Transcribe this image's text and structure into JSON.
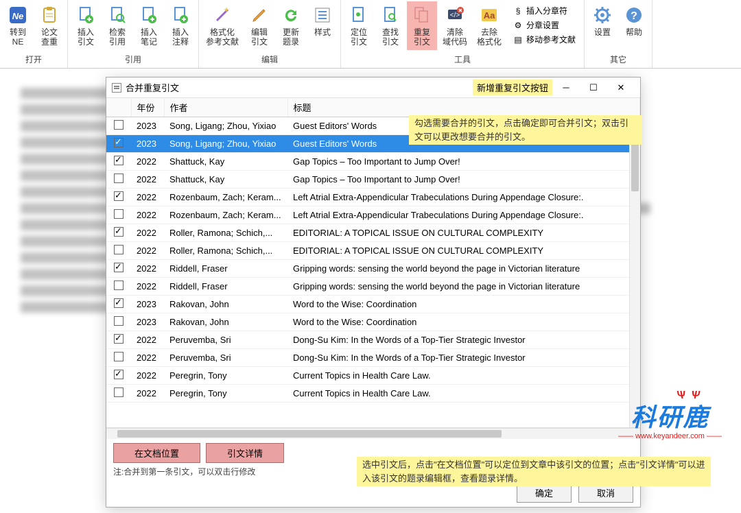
{
  "ribbon": {
    "groups": [
      {
        "label": "打开",
        "items": [
          {
            "id": "to-ne",
            "label": "转到\nNE",
            "icon": "ne"
          },
          {
            "id": "check-dup",
            "label": "论文\n查重",
            "icon": "clipboard"
          }
        ]
      },
      {
        "label": "引用",
        "items": [
          {
            "id": "insert-cite",
            "label": "插入\n引文",
            "icon": "doc-add"
          },
          {
            "id": "search-cite",
            "label": "检索\n引用",
            "icon": "doc-search"
          },
          {
            "id": "insert-note",
            "label": "插入\n笔记",
            "icon": "doc-add"
          },
          {
            "id": "insert-annot",
            "label": "插入\n注释",
            "icon": "doc-add"
          }
        ]
      },
      {
        "label": "编辑",
        "items": [
          {
            "id": "format-refs",
            "label": "格式化\n参考文献",
            "icon": "wand"
          },
          {
            "id": "edit-cite",
            "label": "编辑\n引文",
            "icon": "pencil"
          },
          {
            "id": "update-toc",
            "label": "更新\n题录",
            "icon": "refresh"
          },
          {
            "id": "style",
            "label": "样式",
            "icon": "list"
          }
        ]
      },
      {
        "label": "工具",
        "items": [
          {
            "id": "locate-cite",
            "label": "定位\n引文",
            "icon": "doc-pos"
          },
          {
            "id": "find-cite",
            "label": "查找\n引文",
            "icon": "doc-find"
          },
          {
            "id": "dup-cite",
            "label": "重复\n引文",
            "icon": "doc-dup",
            "active": true
          },
          {
            "id": "clear-code",
            "label": "清除\n域代码",
            "icon": "code-del"
          },
          {
            "id": "remove-fmt",
            "label": "去除\n格式化",
            "icon": "aa"
          }
        ],
        "mini": [
          {
            "id": "insert-section",
            "label": "插入分章符",
            "icon": "section"
          },
          {
            "id": "section-settings",
            "label": "分章设置",
            "icon": "gear-sm"
          },
          {
            "id": "move-refs",
            "label": "移动参考文献",
            "icon": "move"
          }
        ]
      },
      {
        "label": "其它",
        "items": [
          {
            "id": "settings",
            "label": "设置",
            "icon": "gear"
          },
          {
            "id": "help",
            "label": "帮助",
            "icon": "help"
          }
        ]
      }
    ]
  },
  "dialog": {
    "title": "合并重复引文",
    "hint_new_button": "新增重复引文按钮",
    "columns": {
      "check": "",
      "year": "年份",
      "author": "作者",
      "title": "标题"
    },
    "rows": [
      {
        "checked": false,
        "selected": false,
        "year": "2023",
        "author": "Song, Ligang; Zhou, Yixiao",
        "title": "Guest Editors' Words"
      },
      {
        "checked": true,
        "selected": true,
        "year": "2023",
        "author": "Song, Ligang; Zhou, Yixiao",
        "title": "Guest Editors' Words"
      },
      {
        "checked": true,
        "selected": false,
        "year": "2022",
        "author": "Shattuck, Kay",
        "title": "Gap Topics – Too Important to Jump Over!"
      },
      {
        "checked": false,
        "selected": false,
        "year": "2022",
        "author": "Shattuck, Kay",
        "title": "Gap Topics – Too Important to Jump Over!"
      },
      {
        "checked": true,
        "selected": false,
        "year": "2022",
        "author": "Rozenbaum, Zach; Keram...",
        "title": "Left Atrial Extra-Appendicular Trabeculations During Appendage Closure:."
      },
      {
        "checked": false,
        "selected": false,
        "year": "2022",
        "author": "Rozenbaum, Zach; Keram...",
        "title": "Left Atrial Extra-Appendicular Trabeculations During Appendage Closure:."
      },
      {
        "checked": true,
        "selected": false,
        "year": "2022",
        "author": "Roller, Ramona; Schich,...",
        "title": "EDITORIAL: A TOPICAL ISSUE ON CULTURAL COMPLEXITY"
      },
      {
        "checked": false,
        "selected": false,
        "year": "2022",
        "author": "Roller, Ramona; Schich,...",
        "title": "EDITORIAL: A TOPICAL ISSUE ON CULTURAL COMPLEXITY"
      },
      {
        "checked": true,
        "selected": false,
        "year": "2022",
        "author": "Riddell, Fraser",
        "title": "Gripping words: sensing the world beyond the page in Victorian literature"
      },
      {
        "checked": false,
        "selected": false,
        "year": "2022",
        "author": "Riddell, Fraser",
        "title": "Gripping words: sensing the world beyond the page in Victorian literature"
      },
      {
        "checked": true,
        "selected": false,
        "year": "2023",
        "author": "Rakovan, John",
        "title": "Word to the Wise: Coordination"
      },
      {
        "checked": false,
        "selected": false,
        "year": "2023",
        "author": "Rakovan, John",
        "title": "Word to the Wise: Coordination"
      },
      {
        "checked": true,
        "selected": false,
        "year": "2022",
        "author": "Peruvemba, Sri",
        "title": "Dong-Su Kim: In the Words of a Top-Tier Strategic Investor"
      },
      {
        "checked": false,
        "selected": false,
        "year": "2022",
        "author": "Peruvemba, Sri",
        "title": "Dong-Su Kim: In the Words of a Top-Tier Strategic Investor"
      },
      {
        "checked": true,
        "selected": false,
        "year": "2022",
        "author": "Peregrin, Tony",
        "title": "Current Topics in Health Care Law."
      },
      {
        "checked": false,
        "selected": false,
        "year": "2022",
        "author": "Peregrin, Tony",
        "title": "Current Topics in Health Care Law."
      }
    ],
    "buttons": {
      "doc_pos": "在文档位置",
      "cite_detail": "引文详情",
      "ok": "确定",
      "cancel": "取消"
    },
    "note": "注:合并到第一条引文，可以双击行修改"
  },
  "callouts": {
    "c1": "勾选需要合并的引文，点击确定即可合并引文；双击引文可以更改想要合并的引文。",
    "c2": "选中引文后，点击\"在文档位置\"可以定位到文章中该引文的位置；点击\"引文详情\"可以进入该引文的题录编辑框，查看题录详情。"
  },
  "watermark": {
    "main": "科研鹿",
    "sub": "—— www.keyandeer.com ——"
  }
}
